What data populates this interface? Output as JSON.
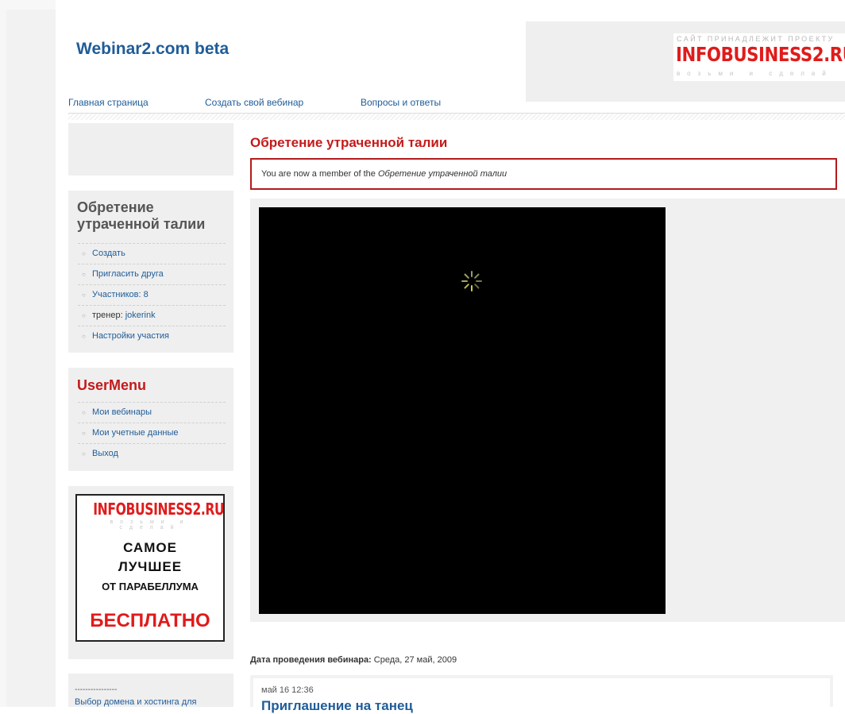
{
  "header": {
    "site_title": "Webinar2.com beta",
    "banner": {
      "top_text": "САЙТ ПРИНАДЛЕЖИТ ПРОЕКТУ",
      "logo_text": "INFOBUSINESS2.RU",
      "tagline": "возьми и сделай"
    }
  },
  "nav": {
    "items": [
      "Главная страница",
      "Создать свой вебинар",
      "Вопросы и ответы"
    ]
  },
  "sidebar": {
    "group_title": "Обретение утраченной талии",
    "group_items": [
      {
        "label": "Создать"
      },
      {
        "label": "Пригласить друга"
      },
      {
        "label": "Участников: 8"
      },
      {
        "prefix": "тренер: ",
        "label": "jokerink"
      },
      {
        "label": "Настройки участия"
      }
    ],
    "usermenu_title": "UserMenu",
    "usermenu_items": [
      "Мои вебинары",
      "Мои учетные данные",
      "Выход"
    ],
    "promo": {
      "logo": "INFOBUSINESS2.RU",
      "logo_sub": "возьми и сделай",
      "line1": "САМОЕ",
      "line2": "ЛУЧШЕЕ",
      "line3": "ОТ ПАРАБЕЛЛУМА",
      "line4": "БЕСПЛАТНО"
    },
    "ad": {
      "dashes": "----------------",
      "link": "Выбор домена и хостинга для"
    }
  },
  "main": {
    "title": "Обретение утраченной талии",
    "message_prefix": "You are now a member of the ",
    "message_group": "Обретение утраченной талии",
    "date_label": "Дата проведения вебинара:",
    "date_value": " Среда, 27 май, 2009",
    "post": {
      "date": "май 16 12:36",
      "title": "Приглашение на танец"
    }
  },
  "colors": {
    "accent_red": "#c41a1a",
    "link_blue": "#1f5c99",
    "panel_gray": "#efefef"
  }
}
